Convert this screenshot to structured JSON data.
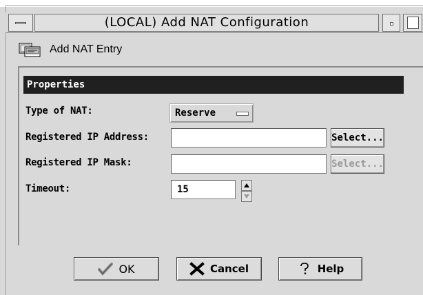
{
  "window": {
    "title": "(LOCAL) Add NAT Configuration"
  },
  "header": {
    "title": "Add NAT Entry",
    "icon": "nat-entry-icon"
  },
  "properties": {
    "section_label": "Properties",
    "type_of_nat": {
      "label": "Type of NAT:",
      "value": "Reserve"
    },
    "registered_ip_address": {
      "label": "Registered IP Address:",
      "value": "",
      "select_label": "Select..."
    },
    "registered_ip_mask": {
      "label": "Registered IP Mask:",
      "value": "",
      "select_label": "Select..."
    },
    "timeout": {
      "label": "Timeout:",
      "value": "15"
    }
  },
  "buttons": {
    "ok_label": "OK",
    "cancel_label": "Cancel",
    "help_label": "Help"
  },
  "colors": {
    "window_bg": "#d9d9d9",
    "section_header_bg": "#202020",
    "section_header_fg": "#ffffff",
    "disabled_text": "#9a9a9a"
  }
}
